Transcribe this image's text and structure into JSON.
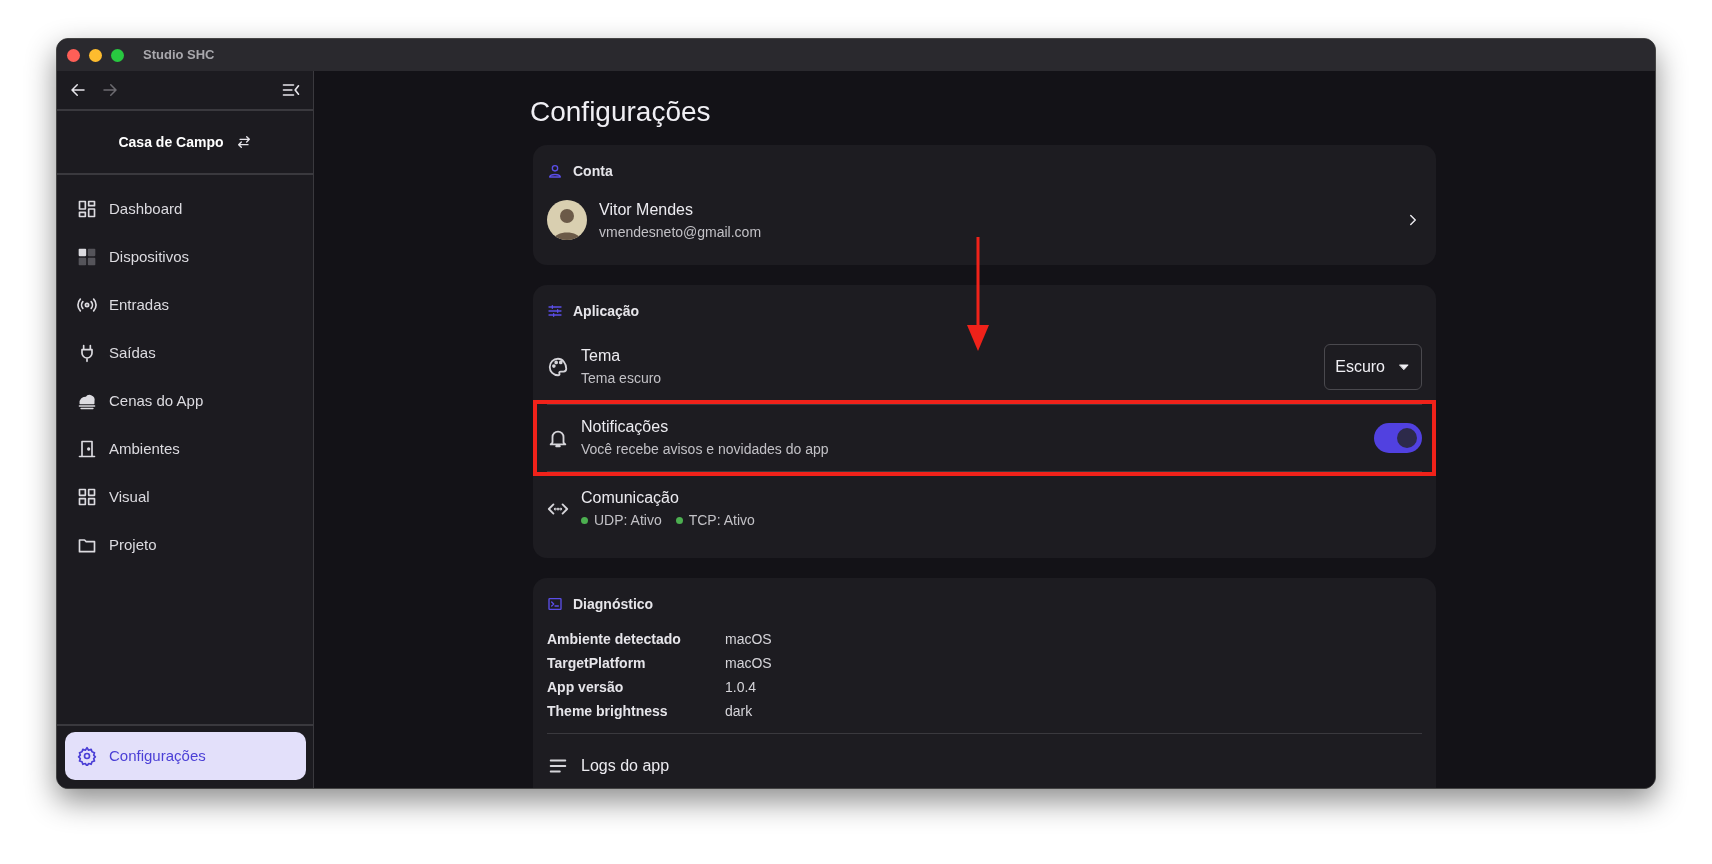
{
  "window": {
    "title": "Studio SHC"
  },
  "nav": [
    {
      "kind": "back",
      "disabled": false
    },
    {
      "kind": "forward",
      "disabled": true
    }
  ],
  "sidebar": {
    "project": "Casa de Campo",
    "items": [
      {
        "label": "Dashboard",
        "selected": false
      },
      {
        "label": "Dispositivos",
        "selected": false
      },
      {
        "label": "Entradas",
        "selected": false
      },
      {
        "label": "Saídas",
        "selected": false
      },
      {
        "label": "Cenas do App",
        "selected": false
      },
      {
        "label": "Ambientes",
        "selected": false
      },
      {
        "label": "Visual",
        "selected": false
      },
      {
        "label": "Projeto",
        "selected": false
      }
    ],
    "footer_items": [
      {
        "label": "Configurações",
        "selected": true
      }
    ]
  },
  "page": {
    "title": "Configurações",
    "sections": [
      {
        "kind": "account",
        "title": "Conta",
        "account": {
          "name": "Vitor Mendes",
          "email": "vmendesneto@gmail.com"
        }
      },
      {
        "kind": "settings",
        "title": "Aplicação",
        "settings": [
          {
            "kind": "select",
            "title": "Tema",
            "subtitle": "Tema escuro",
            "value": "Escuro"
          },
          {
            "kind": "toggle",
            "title": "Notificações",
            "subtitle": "Você recebe avisos e novidades do app",
            "on": true,
            "highlighted": true
          },
          {
            "kind": "status",
            "title": "Comunicação",
            "statuses": [
              {
                "label": "UDP: Ativo",
                "color": "#4caf50"
              },
              {
                "label": "TCP: Ativo",
                "color": "#4caf50"
              }
            ]
          }
        ]
      },
      {
        "kind": "diagnostics",
        "title": "Diagnóstico",
        "rows": [
          {
            "label": "Ambiente detectado",
            "value": "macOS"
          },
          {
            "label": "TargetPlatform",
            "value": "macOS"
          },
          {
            "label": "App versão",
            "value": "1.0.4"
          },
          {
            "label": "Theme brightness",
            "value": "dark"
          }
        ],
        "items": [
          {
            "title": "Logs do app"
          }
        ]
      }
    ]
  }
}
